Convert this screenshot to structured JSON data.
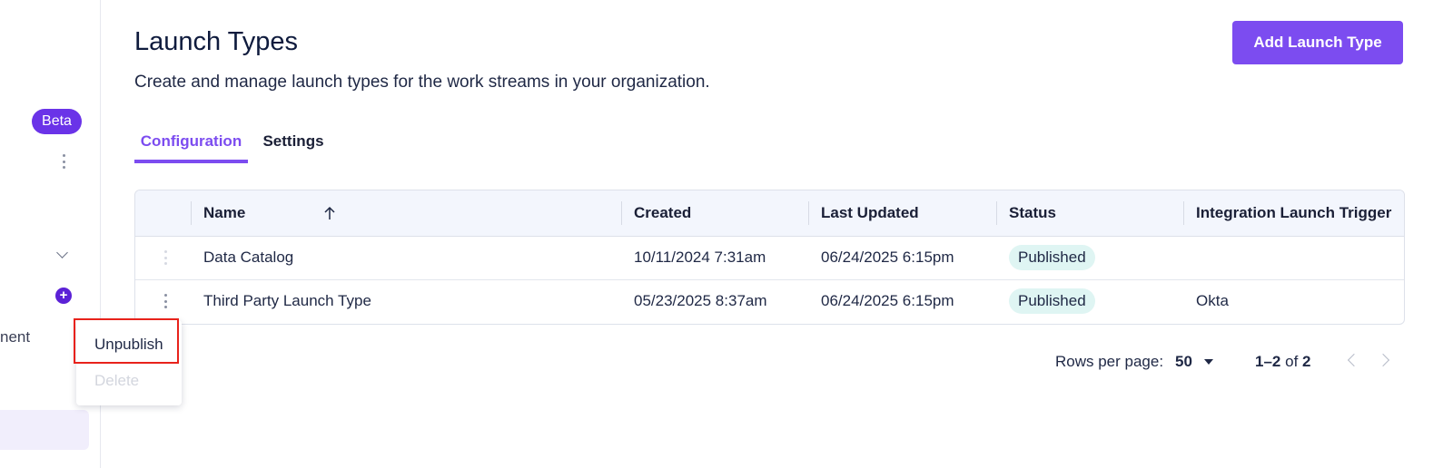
{
  "sidebar": {
    "badge": "Beta",
    "partial_item_text": "nent"
  },
  "header": {
    "title": "Launch Types",
    "subtitle": "Create and manage launch types for the work streams in your organization.",
    "add_button_label": "Add Launch Type"
  },
  "tabs": [
    {
      "label": "Configuration",
      "active": true
    },
    {
      "label": "Settings",
      "active": false
    }
  ],
  "table": {
    "columns": [
      "Name",
      "Created",
      "Last Updated",
      "Status",
      "Integration Launch Trigger"
    ],
    "sort": {
      "column": "Name",
      "direction": "ascending"
    },
    "rows": [
      {
        "name": "Data Catalog",
        "created": "10/11/2024 7:31am",
        "last_updated": "06/24/2025 6:15pm",
        "status": "Published",
        "trigger": ""
      },
      {
        "name": "Third Party Launch Type",
        "created": "05/23/2025 8:37am",
        "last_updated": "06/24/2025 6:15pm",
        "status": "Published",
        "trigger": "Okta"
      }
    ]
  },
  "pagination": {
    "rows_per_page_label": "Rows per page:",
    "rows_per_page_value": "50",
    "range_start_end": "1–2",
    "range_of": "of",
    "range_total": "2"
  },
  "context_menu": {
    "items": [
      {
        "label": "Unpublish",
        "enabled": true,
        "highlighted": true
      },
      {
        "label": "Delete",
        "enabled": false
      }
    ]
  },
  "colors": {
    "accent": "#7c4cf0",
    "badge_bg": "#6a33e8",
    "status_bg": "#dff5f3",
    "highlight_border": "#e8221b"
  },
  "icons": [
    "kebab-menu-icon",
    "chevron-down-icon",
    "plus-icon",
    "sort-up-arrow-icon",
    "caret-down-icon",
    "chevron-left-icon",
    "chevron-right-icon"
  ]
}
